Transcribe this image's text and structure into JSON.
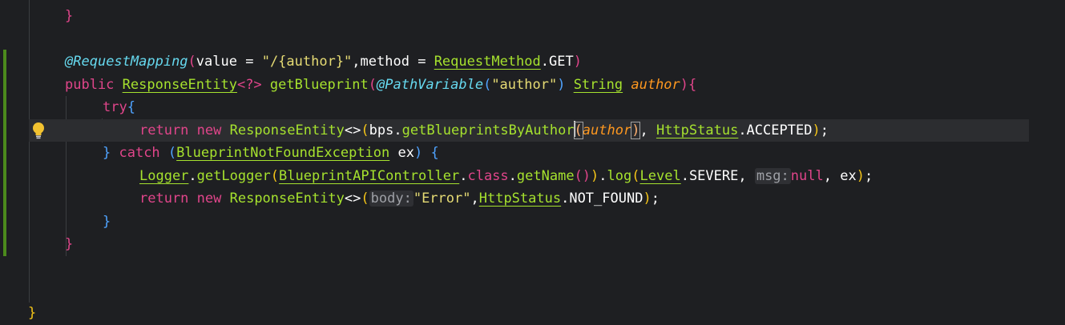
{
  "code_lines": [
    {
      "tokens": [
        "}"
      ]
    },
    {
      "tokens": []
    },
    {
      "tokens": [
        "@",
        "RequestMapping",
        "(",
        "value",
        " = ",
        "\"/{author}\"",
        ",",
        "method",
        " = ",
        "RequestMethod",
        ".GET",
        ")"
      ]
    },
    {
      "tokens": [
        "public ",
        "ResponseEntity",
        "<?>",
        " getBlueprint",
        "(",
        "@",
        "PathVariable",
        "(",
        "\"author\"",
        ") ",
        "String",
        " ",
        "author",
        ")",
        "{"
      ]
    },
    {
      "tokens": [
        "try",
        "{"
      ]
    },
    {
      "tokens": [
        "return ",
        "new ",
        "ResponseEntity",
        "<>",
        "(",
        "bps",
        ".",
        "getBlueprintsByAuthor",
        "(",
        "author",
        ")",
        ", ",
        "HttpStatus",
        ".ACCEPTED",
        ")",
        ";"
      ]
    },
    {
      "tokens": [
        "} ",
        "catch ",
        "(",
        "BlueprintNotFoundException",
        " ex",
        ") ",
        "{"
      ]
    },
    {
      "tokens": [
        "Logger",
        ".",
        "getLogger",
        "(",
        "BlueprintAPIController",
        ".",
        "class",
        ".",
        "getName",
        "()",
        ")",
        ".",
        "log",
        "(",
        "Level",
        ".SEVERE, ",
        "msg:",
        "null",
        ", ex",
        ")",
        ";"
      ]
    },
    {
      "tokens": [
        "return ",
        "new ",
        "ResponseEntity",
        "<>",
        "(",
        "body:",
        "\"Error\"",
        ",",
        "HttpStatus",
        ".NOT_FOUND",
        ")",
        ";"
      ]
    },
    {
      "tokens": [
        "}"
      ]
    },
    {
      "tokens": [
        "}"
      ]
    },
    {
      "tokens": []
    },
    {
      "tokens": []
    },
    {
      "tokens": [
        "}"
      ]
    }
  ],
  "icons": {
    "intention": "lightbulb-icon"
  },
  "colors": {
    "background": "#1e1f22",
    "keyword": "#e0458a",
    "type": "#a6e22e",
    "string": "#e6db74",
    "annotation": "#66d9ef",
    "parameter": "#fd971f",
    "vcs_change_marker": "#4c8a1c"
  }
}
